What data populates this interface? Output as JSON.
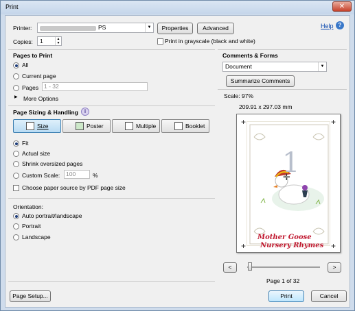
{
  "window": {
    "title": "Print",
    "close_label": "✕"
  },
  "printer": {
    "label": "Printer:",
    "value": "PS",
    "properties_label": "Properties",
    "advanced_label": "Advanced",
    "help_label": "Help",
    "help_icon": "help-icon"
  },
  "copies": {
    "label": "Copies:",
    "value": "1"
  },
  "grayscale": {
    "label": "Print in grayscale (black and white)",
    "checked": false
  },
  "pages": {
    "title": "Pages to Print",
    "all": "All",
    "current": "Current page",
    "pages": "Pages",
    "pages_placeholder": "1 - 32",
    "more_options": "More Options"
  },
  "sizing": {
    "title": "Page Sizing & Handling",
    "buttons": [
      "Size",
      "Poster",
      "Multiple",
      "Booklet"
    ],
    "fit": "Fit",
    "actual": "Actual size",
    "shrink": "Shrink oversized pages",
    "custom": "Custom Scale:",
    "custom_value": "100",
    "percent": "%",
    "choose_source": "Choose paper source by PDF page size"
  },
  "orientation": {
    "title": "Orientation:",
    "auto": "Auto portrait/landscape",
    "portrait": "Portrait",
    "landscape": "Landscape"
  },
  "comments": {
    "title": "Comments & Forms",
    "value": "Document",
    "summarize_label": "Summarize Comments"
  },
  "preview": {
    "scale": "Scale: 97%",
    "dimensions": "209.91 x 297.03 mm",
    "page_info": "Page 1 of 32",
    "number": "1",
    "book_title_1": "Mother Goose",
    "book_title_2": "Nursery Rhymes",
    "prev_label": "<",
    "next_label": ">",
    "slider_position": 0
  },
  "footer": {
    "page_setup_label": "Page Setup...",
    "print_label": "Print",
    "cancel_label": "Cancel"
  }
}
